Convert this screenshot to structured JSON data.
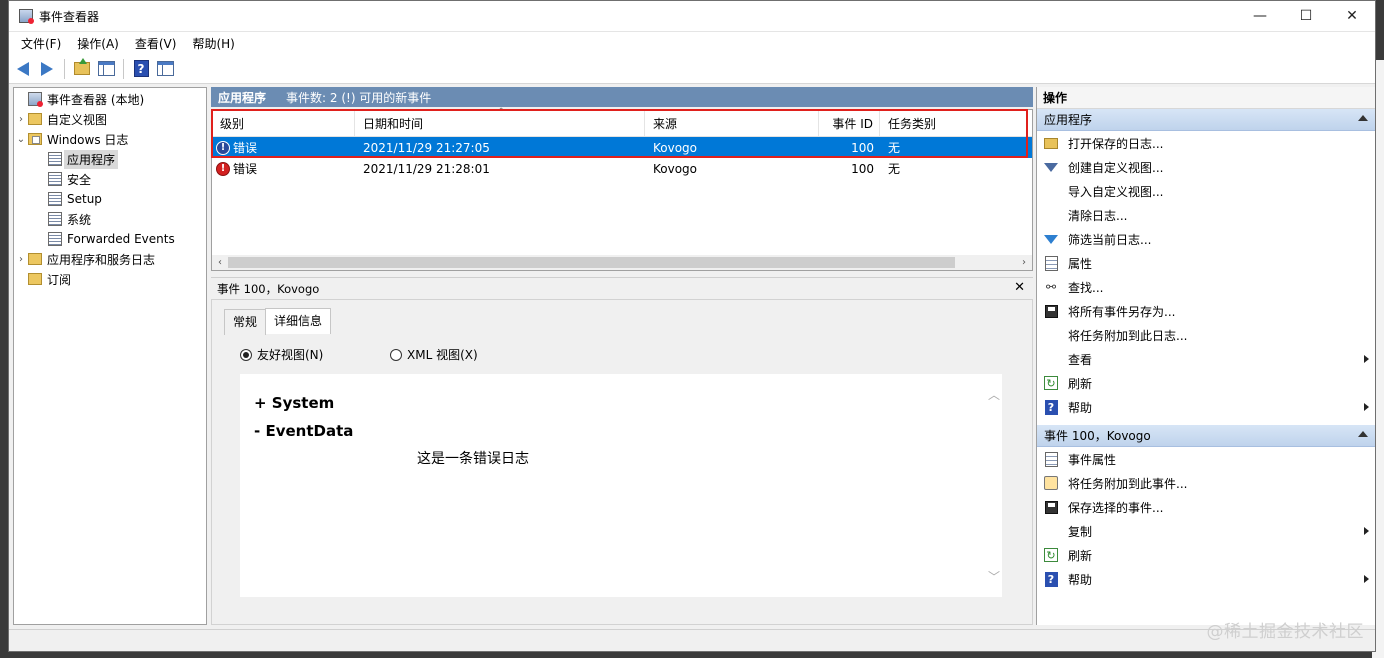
{
  "window": {
    "title": "事件查看器",
    "minimize": "—",
    "maximize": "☐",
    "close": "✕"
  },
  "menu": [
    "文件(F)",
    "操作(A)",
    "查看(V)",
    "帮助(H)"
  ],
  "tree": {
    "root": "事件查看器 (本地)",
    "custom_views": "自定义视图",
    "windows_logs": "Windows 日志",
    "logs": [
      "应用程序",
      "安全",
      "Setup",
      "系统",
      "Forwarded Events"
    ],
    "app_service_logs": "应用程序和服务日志",
    "subscriptions": "订阅"
  },
  "center": {
    "title": "应用程序",
    "subtitle": "事件数: 2 (!) 可用的新事件",
    "columns": [
      "级别",
      "日期和时间",
      "来源",
      "事件 ID",
      "任务类别"
    ],
    "rows": [
      {
        "level": "错误",
        "datetime": "2021/11/29 21:27:05",
        "source": "Kovogo",
        "id": "100",
        "task": "无",
        "selected": true
      },
      {
        "level": "错误",
        "datetime": "2021/11/29 21:28:01",
        "source": "Kovogo",
        "id": "100",
        "task": "无",
        "selected": false
      }
    ]
  },
  "detail": {
    "header": "事件 100，Kovogo",
    "tabs": [
      "常规",
      "详细信息"
    ],
    "active_tab": "详细信息",
    "radio_friendly": "友好视图(N)",
    "radio_xml": "XML 视图(X)",
    "system_line": "+  System",
    "eventdata_line": "-  EventData",
    "message": "这是一条错误日志"
  },
  "actions": {
    "title": "操作",
    "group1": "应用程序",
    "group1_items": [
      "打开保存的日志...",
      "创建自定义视图...",
      "导入自定义视图...",
      "清除日志...",
      "筛选当前日志...",
      "属性",
      "查找...",
      "将所有事件另存为...",
      "将任务附加到此日志...",
      "查看",
      "刷新",
      "帮助"
    ],
    "group2": "事件 100，Kovogo",
    "group2_items": [
      "事件属性",
      "将任务附加到此事件...",
      "保存选择的事件...",
      "复制",
      "刷新",
      "帮助"
    ]
  },
  "watermark": "@稀土掘金技术社区",
  "colors": {
    "accent": "#0078d7",
    "header": "#6b8cb3",
    "error": "#d32020",
    "highlight_frame": "#e0201c"
  }
}
